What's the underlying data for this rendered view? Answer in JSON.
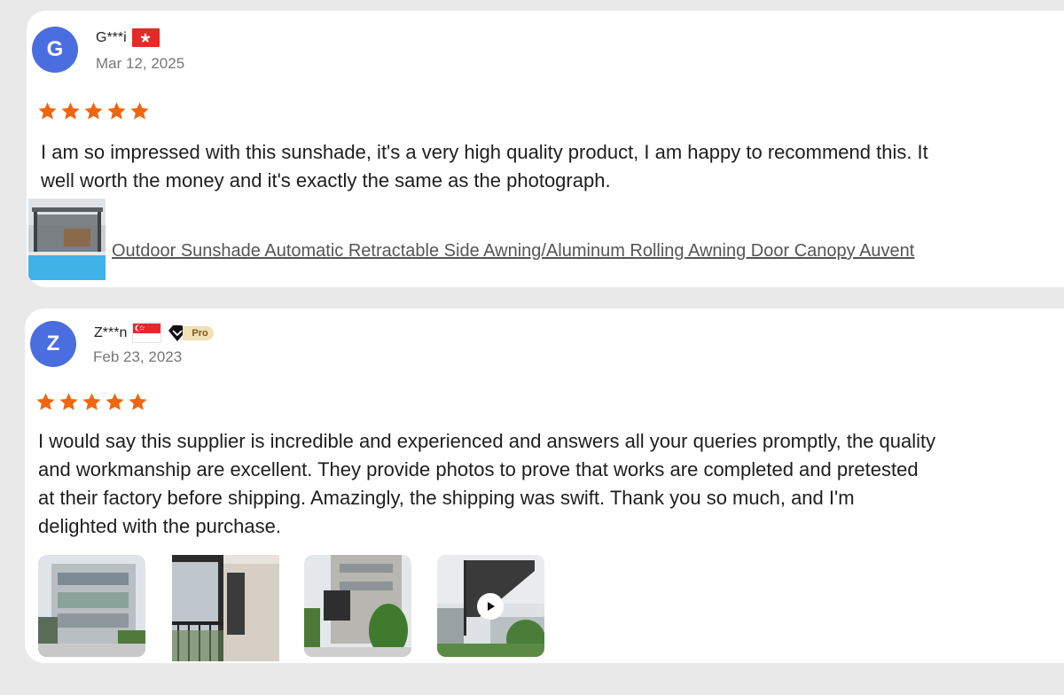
{
  "reviews": [
    {
      "initial": "G",
      "name": "G***i",
      "country_flag": "hong-kong-flag-icon",
      "date": "Mar 12, 2025",
      "rating": 5,
      "text_lines": [
        "I am so impressed with this sunshade, it's a very high quality product, I am happy to recommend this. It",
        "well worth the money and it's exactly the same as the photograph."
      ],
      "product_link": "Outdoor Sunshade Automatic Retractable Side Awning/Aluminum Rolling Awning Door Canopy Auvent"
    },
    {
      "initial": "Z",
      "name": "Z***n",
      "country_flag": "singapore-flag-icon",
      "badge": "Pro",
      "date": "Feb 23, 2023",
      "rating": 5,
      "text_lines": [
        "I would say this supplier is incredible and experienced and answers all your queries promptly, the quality",
        "and workmanship are excellent. They provide photos to prove that works are completed and pretested",
        "at their factory before shipping. Amazingly, the shipping was swift. Thank you so much, and I'm",
        "delighted with the purchase."
      ],
      "photos": [
        "building-photo",
        "balcony-photo",
        "facade-awning-photo",
        "awning-video"
      ]
    }
  ],
  "colors": {
    "avatar": "#4a6ee0",
    "star": "#f0660f",
    "background": "#e9e9e9"
  }
}
